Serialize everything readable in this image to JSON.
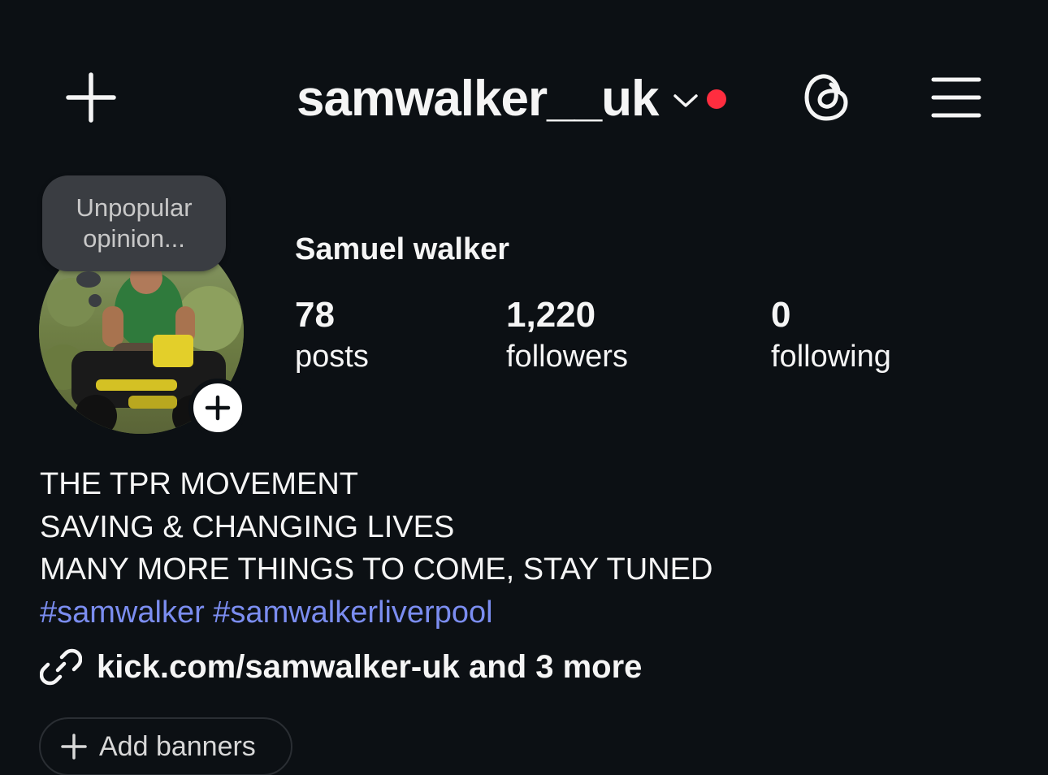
{
  "header": {
    "username": "samwalker__uk",
    "new_post_icon": "plus-icon",
    "account_switch_icon": "chevron-down-icon",
    "notification_dot_color": "#ff2d3f",
    "threads_icon": "threads-icon",
    "menu_icon": "hamburger-menu-icon"
  },
  "profile": {
    "note_lines": [
      "Unpopular",
      "opinion..."
    ],
    "display_name": "Samuel walker",
    "stats": [
      {
        "value": "78",
        "label": "posts"
      },
      {
        "value": "1,220",
        "label": "followers"
      },
      {
        "value": "0",
        "label": "following"
      }
    ]
  },
  "bio": {
    "lines": [
      "THE TPR MOVEMENT",
      "SAVING & CHANGING LIVES",
      "MANY MORE THINGS TO COME, STAY TUNED"
    ],
    "hashtags": [
      "#samwalker",
      "#samwalkerliverpool"
    ],
    "hashtag_color": "#7b8df0",
    "link": "kick.com/samwalker-uk and 3 more"
  },
  "banners": {
    "label": "Add banners"
  },
  "theme": {
    "background": "#0c1014",
    "text": "#f5f5f5"
  }
}
